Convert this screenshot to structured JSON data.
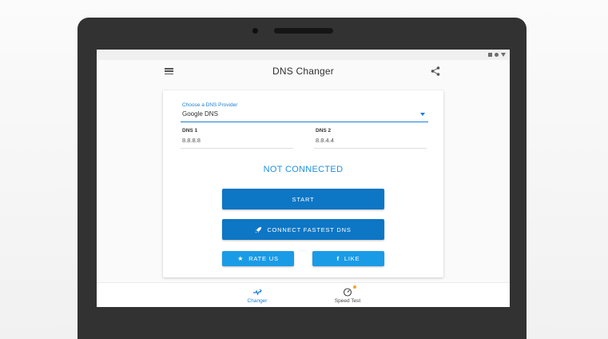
{
  "app": {
    "title": "DNS Changer"
  },
  "provider": {
    "label": "Choose a DNS Provider",
    "value": "Google DNS"
  },
  "dns1": {
    "label": "DNS 1",
    "value": "8.8.8.8"
  },
  "dns2": {
    "label": "DNS 2",
    "value": "8.8.4.4"
  },
  "status": {
    "text": "NOT CONNECTED"
  },
  "buttons": {
    "start": "START",
    "fastest": "CONNECT FASTEST DNS",
    "rate": "RATE US",
    "like": "LIKE"
  },
  "nav": {
    "changer": "Changer",
    "speed_test": "Speed Test"
  },
  "icons": {
    "menu": "menu-icon",
    "share": "share-icon",
    "rocket": "rocket-icon",
    "star": "star-icon",
    "facebook": "facebook-icon",
    "changer": "changer-icon",
    "speedometer": "speedometer-icon"
  },
  "colors": {
    "accent": "#1a7fd6",
    "primary_button": "#0d76c5",
    "secondary_button": "#1a9be6",
    "status_text": "#1c8fe0",
    "notification_dot": "#f4a623"
  }
}
